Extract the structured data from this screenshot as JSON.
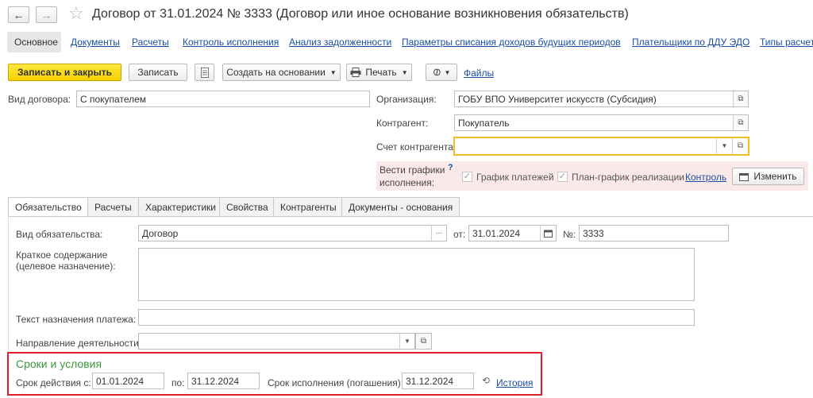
{
  "header": {
    "back_icon": "←",
    "forward_icon": "→",
    "star_icon": "☆",
    "title": "Договор от 31.01.2024 № 3333 (Договор или иное основание возникновения обязательств)"
  },
  "nav": {
    "items": [
      "Основное",
      "Документы",
      "Расчеты",
      "Контроль исполнения",
      "Анализ задолженности",
      "Параметры списания доходов будущих периодов",
      "Плательщики по ДДУ ЭДО",
      "Типы расчет"
    ]
  },
  "toolbar": {
    "save_close": "Записать и закрыть",
    "save": "Записать",
    "create_based": "Создать на основании",
    "print": "Печать",
    "files": "Файлы"
  },
  "form": {
    "contract_type_label": "Вид договора:",
    "contract_type_value": "С покупателем",
    "org_label": "Организация:",
    "org_value": "ГОБУ ВПО Университет искусств (Субсидия)",
    "counterparty_label": "Контрагент:",
    "counterparty_value": "Покупатель",
    "account_label": "Счет контрагента:",
    "account_value": "",
    "schedules_label_1": "Вести графики",
    "schedules_label_2": "исполнения:",
    "help_mark": "?",
    "payment_schedule": "График платежей",
    "sales_plan": "План-график реализации",
    "control_link": "Контроль",
    "change_button": "Изменить"
  },
  "tabs": [
    "Обязательство",
    "Расчеты",
    "Характеристики",
    "Свойства",
    "Контрагенты",
    "Документы - основания"
  ],
  "obligation": {
    "kind_label": "Вид обязательства:",
    "kind_value": "Договор",
    "from_label": "от:",
    "date_value": "31.01.2024",
    "number_label": "№:",
    "number_value": "3333",
    "summary_label_1": "Краткое содержание",
    "summary_label_2": "(целевое назначение):",
    "summary_value": "",
    "purpose_label": "Текст назначения платежа:",
    "purpose_value": "",
    "direction_label": "Направление деятельности:",
    "direction_value": ""
  },
  "terms": {
    "heading": "Сроки и условия",
    "valid_from_label": "Срок действия с:",
    "valid_from": "01.01.2024",
    "to_label": "по:",
    "valid_to": "31.12.2024",
    "due_label": "Срок исполнения (погашения):",
    "due_value": "31.12.2024",
    "history_link": "История"
  },
  "colors": {
    "primary_button": "#f5d000",
    "link": "#1b4fa3",
    "highlight_border": "#e0202a",
    "section_heading": "#3a9a3a",
    "schedule_panel_bg": "#fbe9e9",
    "focused_field_border": "#f0c020"
  }
}
